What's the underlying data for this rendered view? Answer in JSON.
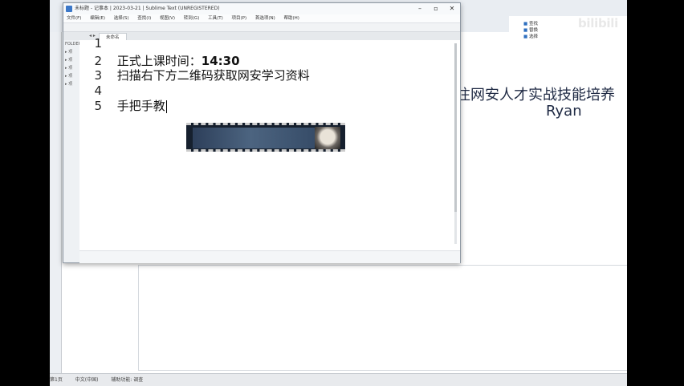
{
  "background": {
    "slide_title": "注网安人才实战技能培养",
    "slide_name": "Ryan",
    "right_panel_items": [
      "查找",
      "替换",
      "选择"
    ],
    "statusbar_items": [
      "第1页",
      "中文(中国)",
      "辅助功能: 调查"
    ]
  },
  "editor_window": {
    "title": "未标题 - 记事本 | 2023-03-21 | Sublime Text (UNREGISTERED)",
    "menu": [
      "文件(F)",
      "编辑(E)",
      "选择(S)",
      "查找(I)",
      "视图(V)",
      "转到(G)",
      "工具(T)",
      "项目(P)",
      "首选项(N)",
      "帮助(H)"
    ],
    "tab_label": "未命名",
    "tab_nav": "◂ ▸",
    "sidebar_items": [
      "FOLDERS",
      "▸ 项",
      "▸ 项",
      "▸ 项",
      "▸ 项",
      "▸ 项"
    ],
    "lines": [
      {
        "n": "1",
        "text": ""
      },
      {
        "n": "2",
        "text": "正式上课时间：",
        "bold": "14:30"
      },
      {
        "n": "3",
        "text": "扫描右下方二维码获取网安学习资料"
      },
      {
        "n": "4",
        "text": ""
      },
      {
        "n": "5",
        "text": "手把手教"
      }
    ]
  },
  "overlay": {
    "brand": "bilibili"
  }
}
